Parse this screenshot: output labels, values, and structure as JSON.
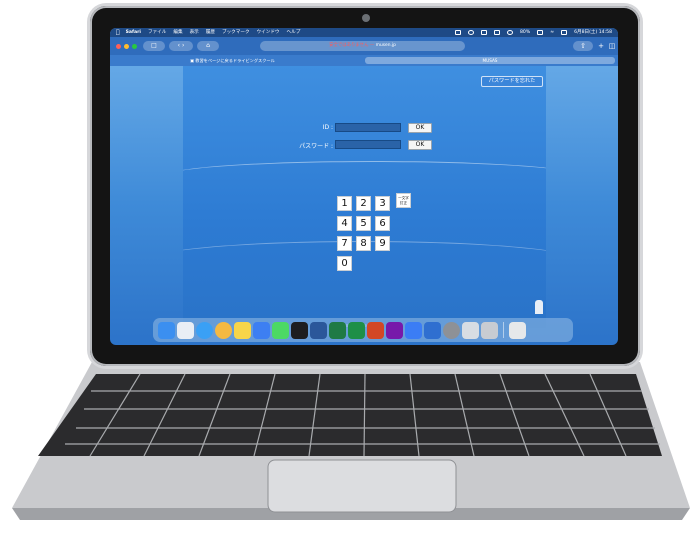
{
  "menubar": {
    "app": "Safari",
    "items": [
      "ファイル",
      "編集",
      "表示",
      "履歴",
      "ブックマーク",
      "ウインドウ",
      "ヘルプ"
    ],
    "battery": "80%",
    "clock": "6月8日(土) 14:58"
  },
  "toolbar": {
    "url_warning": "安全ではありません",
    "url_domain": "musen.jp"
  },
  "tabs": {
    "tab1": "教習をページに戻るドライビングスクール",
    "tab2": "MUSAS"
  },
  "login": {
    "forgot_password": "パスワードを忘れた",
    "id_label": "ID :",
    "password_label": "パスワード :",
    "ok_label": "OK"
  },
  "keypad": {
    "keys": [
      "1",
      "2",
      "3",
      "4",
      "5",
      "6",
      "7",
      "8",
      "9",
      "0"
    ],
    "fix_key": "一文字訂正"
  },
  "dock": {
    "icons": [
      "finder-icon",
      "launchpad-icon",
      "safari-icon",
      "photos-icon",
      "notes-icon",
      "mail-icon",
      "messages-icon",
      "facetime-icon",
      "word-icon",
      "excel-icon",
      "numbers-icon",
      "powerpoint-icon",
      "onenote-icon",
      "app-store-icon",
      "instruments-icon",
      "system-settings-icon",
      "preview-icon",
      "finder-window-icon",
      "trash-icon"
    ],
    "colors": [
      "#3b8ff0",
      "#e9eef5",
      "#3aa0f5",
      "#f5b942",
      "#f7d54a",
      "#3d7ff2",
      "#4cd964",
      "#1d1d1f",
      "#2b579a",
      "#1f7a45",
      "#1e8f47",
      "#d24726",
      "#7719aa",
      "#3b7df5",
      "#2f6fd0",
      "#8e9196",
      "#d8dde3",
      "#c8ccd2",
      "#e6e8ea"
    ]
  }
}
